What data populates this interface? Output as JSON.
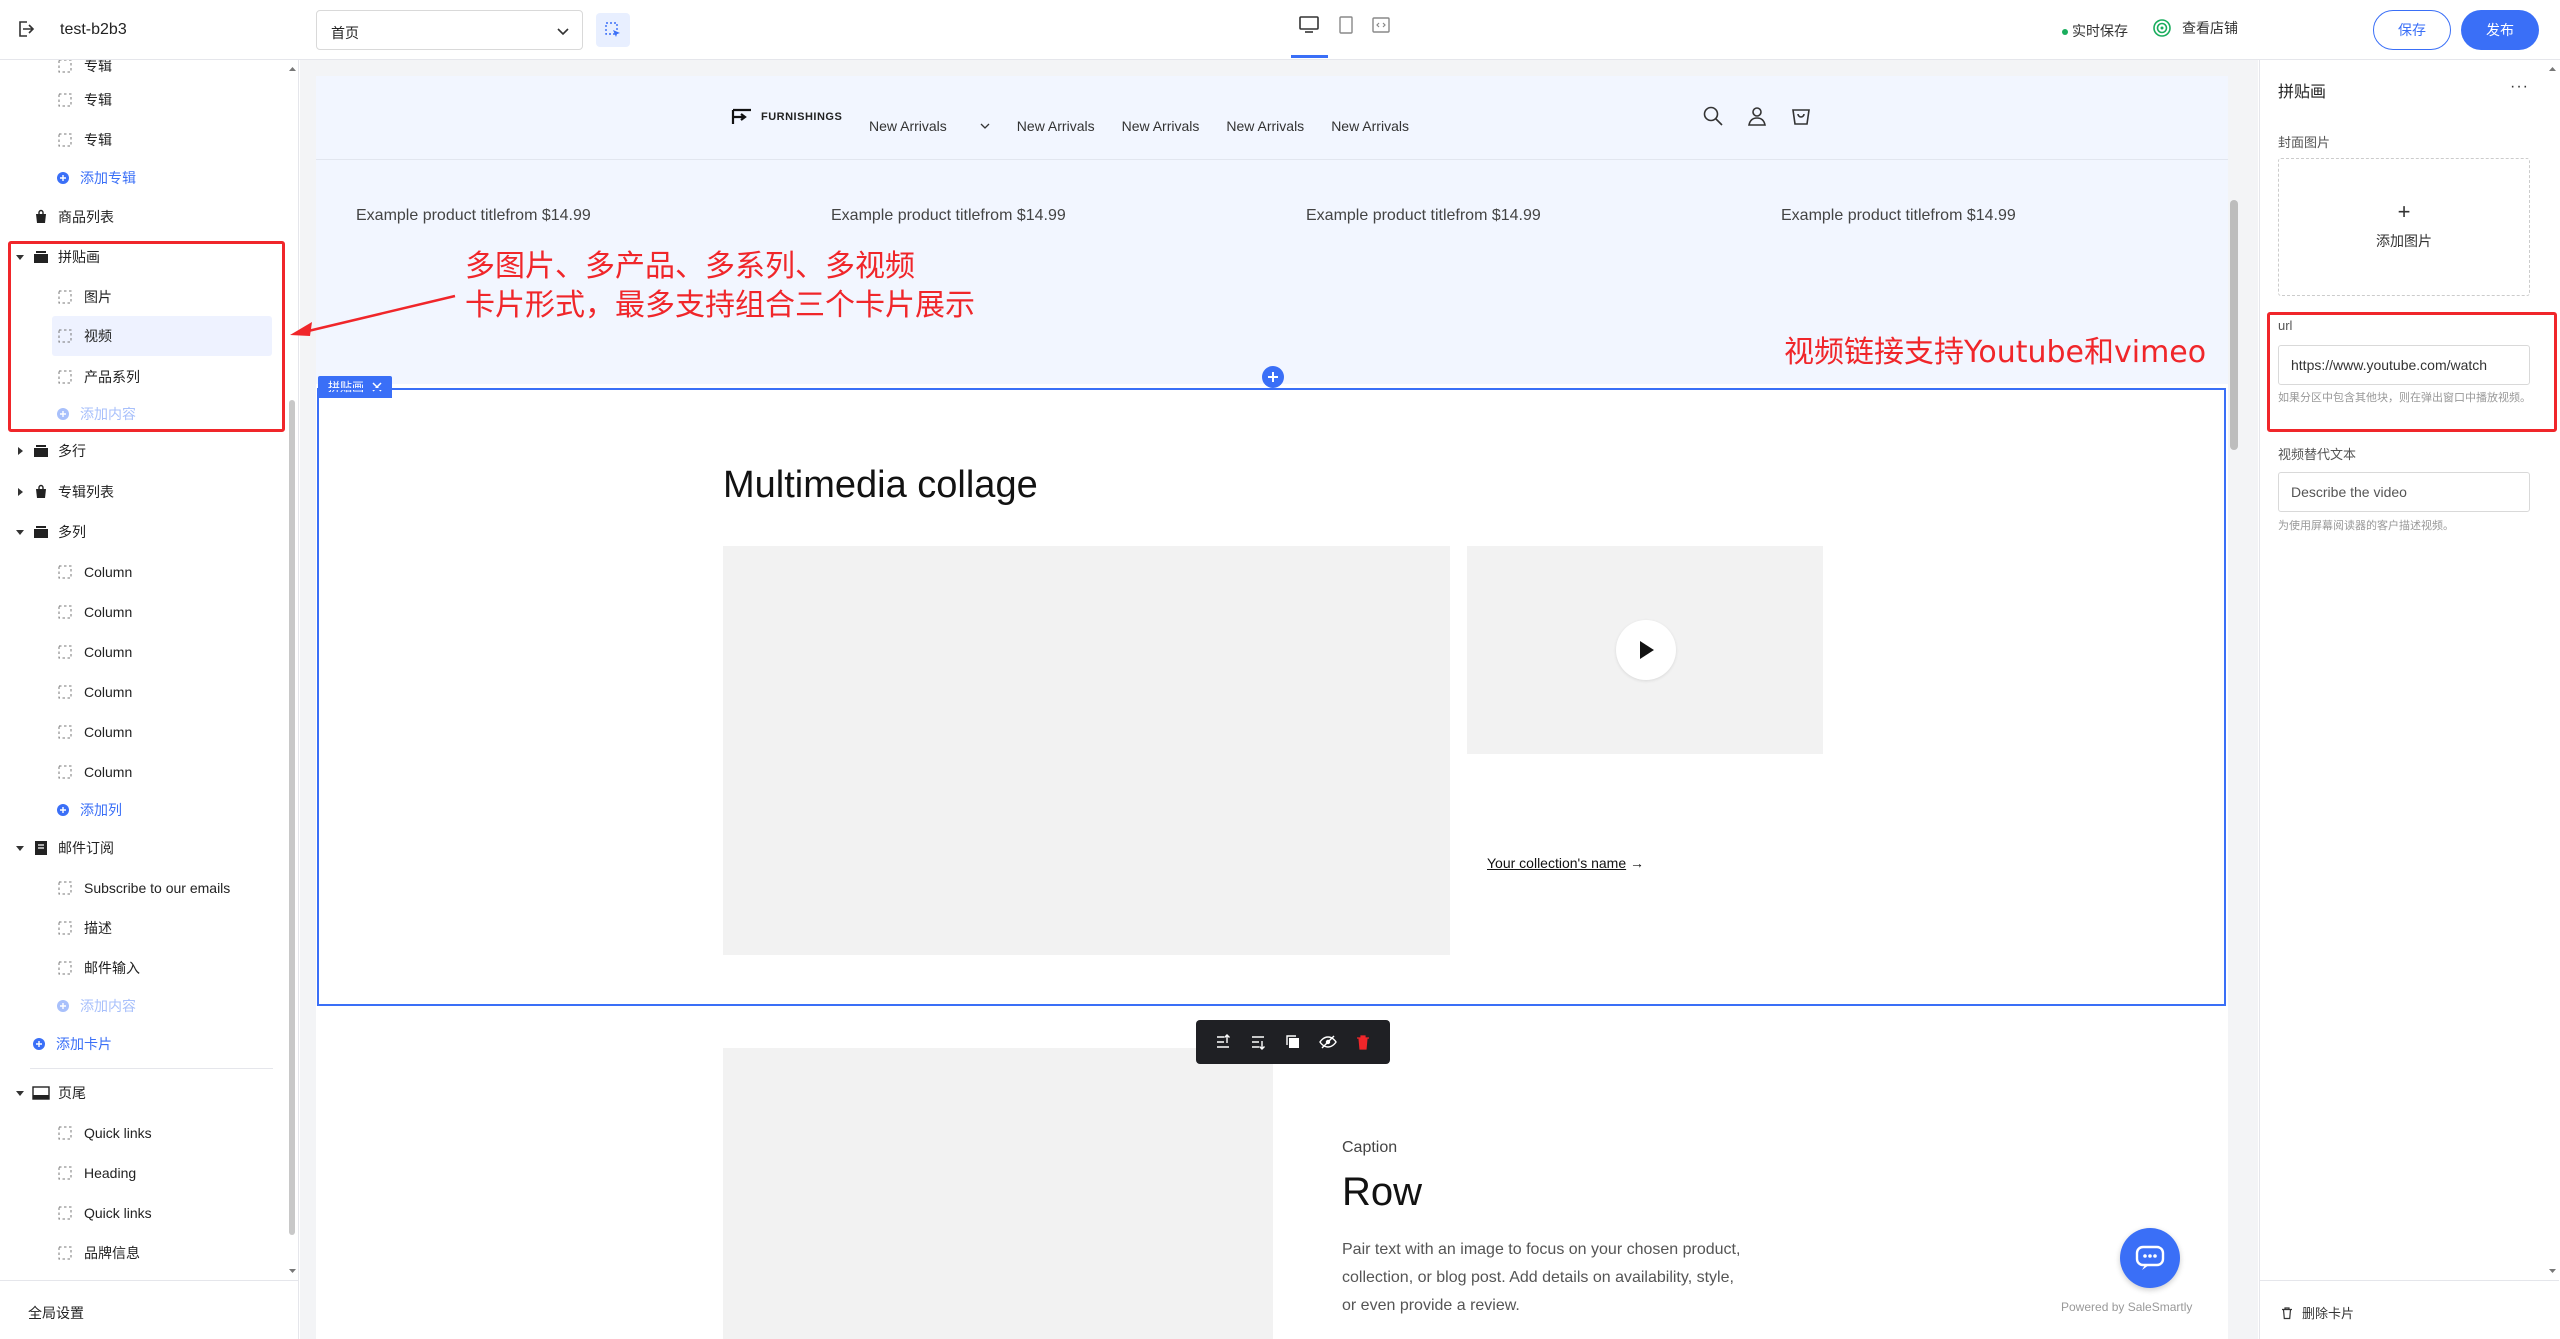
{
  "topbar": {
    "site_name": "test-b2b3",
    "page_select": "首页",
    "autosave": "实时保存",
    "view_store": "查看店铺",
    "save": "保存",
    "publish": "发布"
  },
  "sidebar": {
    "global_settings": "全局设置",
    "rows": {
      "r0": "专辑",
      "r1": "专辑",
      "r2": "专辑",
      "r3": "添加专辑",
      "r4": "商品列表",
      "r5": "拼贴画",
      "r6": "图片",
      "r7": "视频",
      "r8": "产品系列",
      "r9": "添加内容",
      "r10": "多行",
      "r11": "专辑列表",
      "r12": "多列",
      "r13": "Column",
      "r14": "Column",
      "r15": "Column",
      "r16": "Column",
      "r17": "Column",
      "r18": "Column",
      "r19": "添加列",
      "r20": "邮件订阅",
      "r21": "Subscribe to our emails",
      "r22": "描述",
      "r23": "邮件输入",
      "r24": "添加内容",
      "r25": "添加卡片",
      "r26": "页尾",
      "r27": "Quick links",
      "r28": "Heading",
      "r29": "Quick links",
      "r30": "品牌信息"
    }
  },
  "annotations": {
    "left_line1": "多图片、多产品、多系列、多视频",
    "left_line2": "卡片形式，最多支持组合三个卡片展示",
    "right": "视频链接支持Youtube和vimeo"
  },
  "preview": {
    "logo_text": "FURNISHINGS",
    "nav": [
      "New Arrivals",
      "New Arrivals",
      "New Arrivals",
      "New Arrivals",
      "New Arrivals"
    ],
    "products": [
      "Example product titlefrom $14.99",
      "Example product titlefrom $14.99",
      "Example product titlefrom $14.99",
      "Example product titlefrom $14.99"
    ],
    "section_tag": "拼贴画",
    "collage_title": "Multimedia collage",
    "collection_link": "Your collection's name",
    "caption": "Caption",
    "row_title": "Row",
    "row_text": "Pair text with an image to focus on your chosen product, collection, or blog post. Add details on availability, style, or even provide a review.",
    "powered": "Powered by SaleSmartly"
  },
  "rightpanel": {
    "title": "拼贴画",
    "more": "···",
    "cover_label": "封面图片",
    "add_image": "添加图片",
    "url_label": "url",
    "url_value": "https://www.youtube.com/watch",
    "url_help": "如果分区中包含其他块，则在弹出窗口中播放视频。",
    "alt_label": "视频替代文本",
    "alt_placeholder": "Describe the video",
    "alt_help": "为使用屏幕阅读器的客户描述视频。",
    "delete_card": "删除卡片"
  },
  "colors": {
    "accent": "#3a6ff7",
    "annotation_red": "#f0262a",
    "online_green": "#1aad5d"
  }
}
